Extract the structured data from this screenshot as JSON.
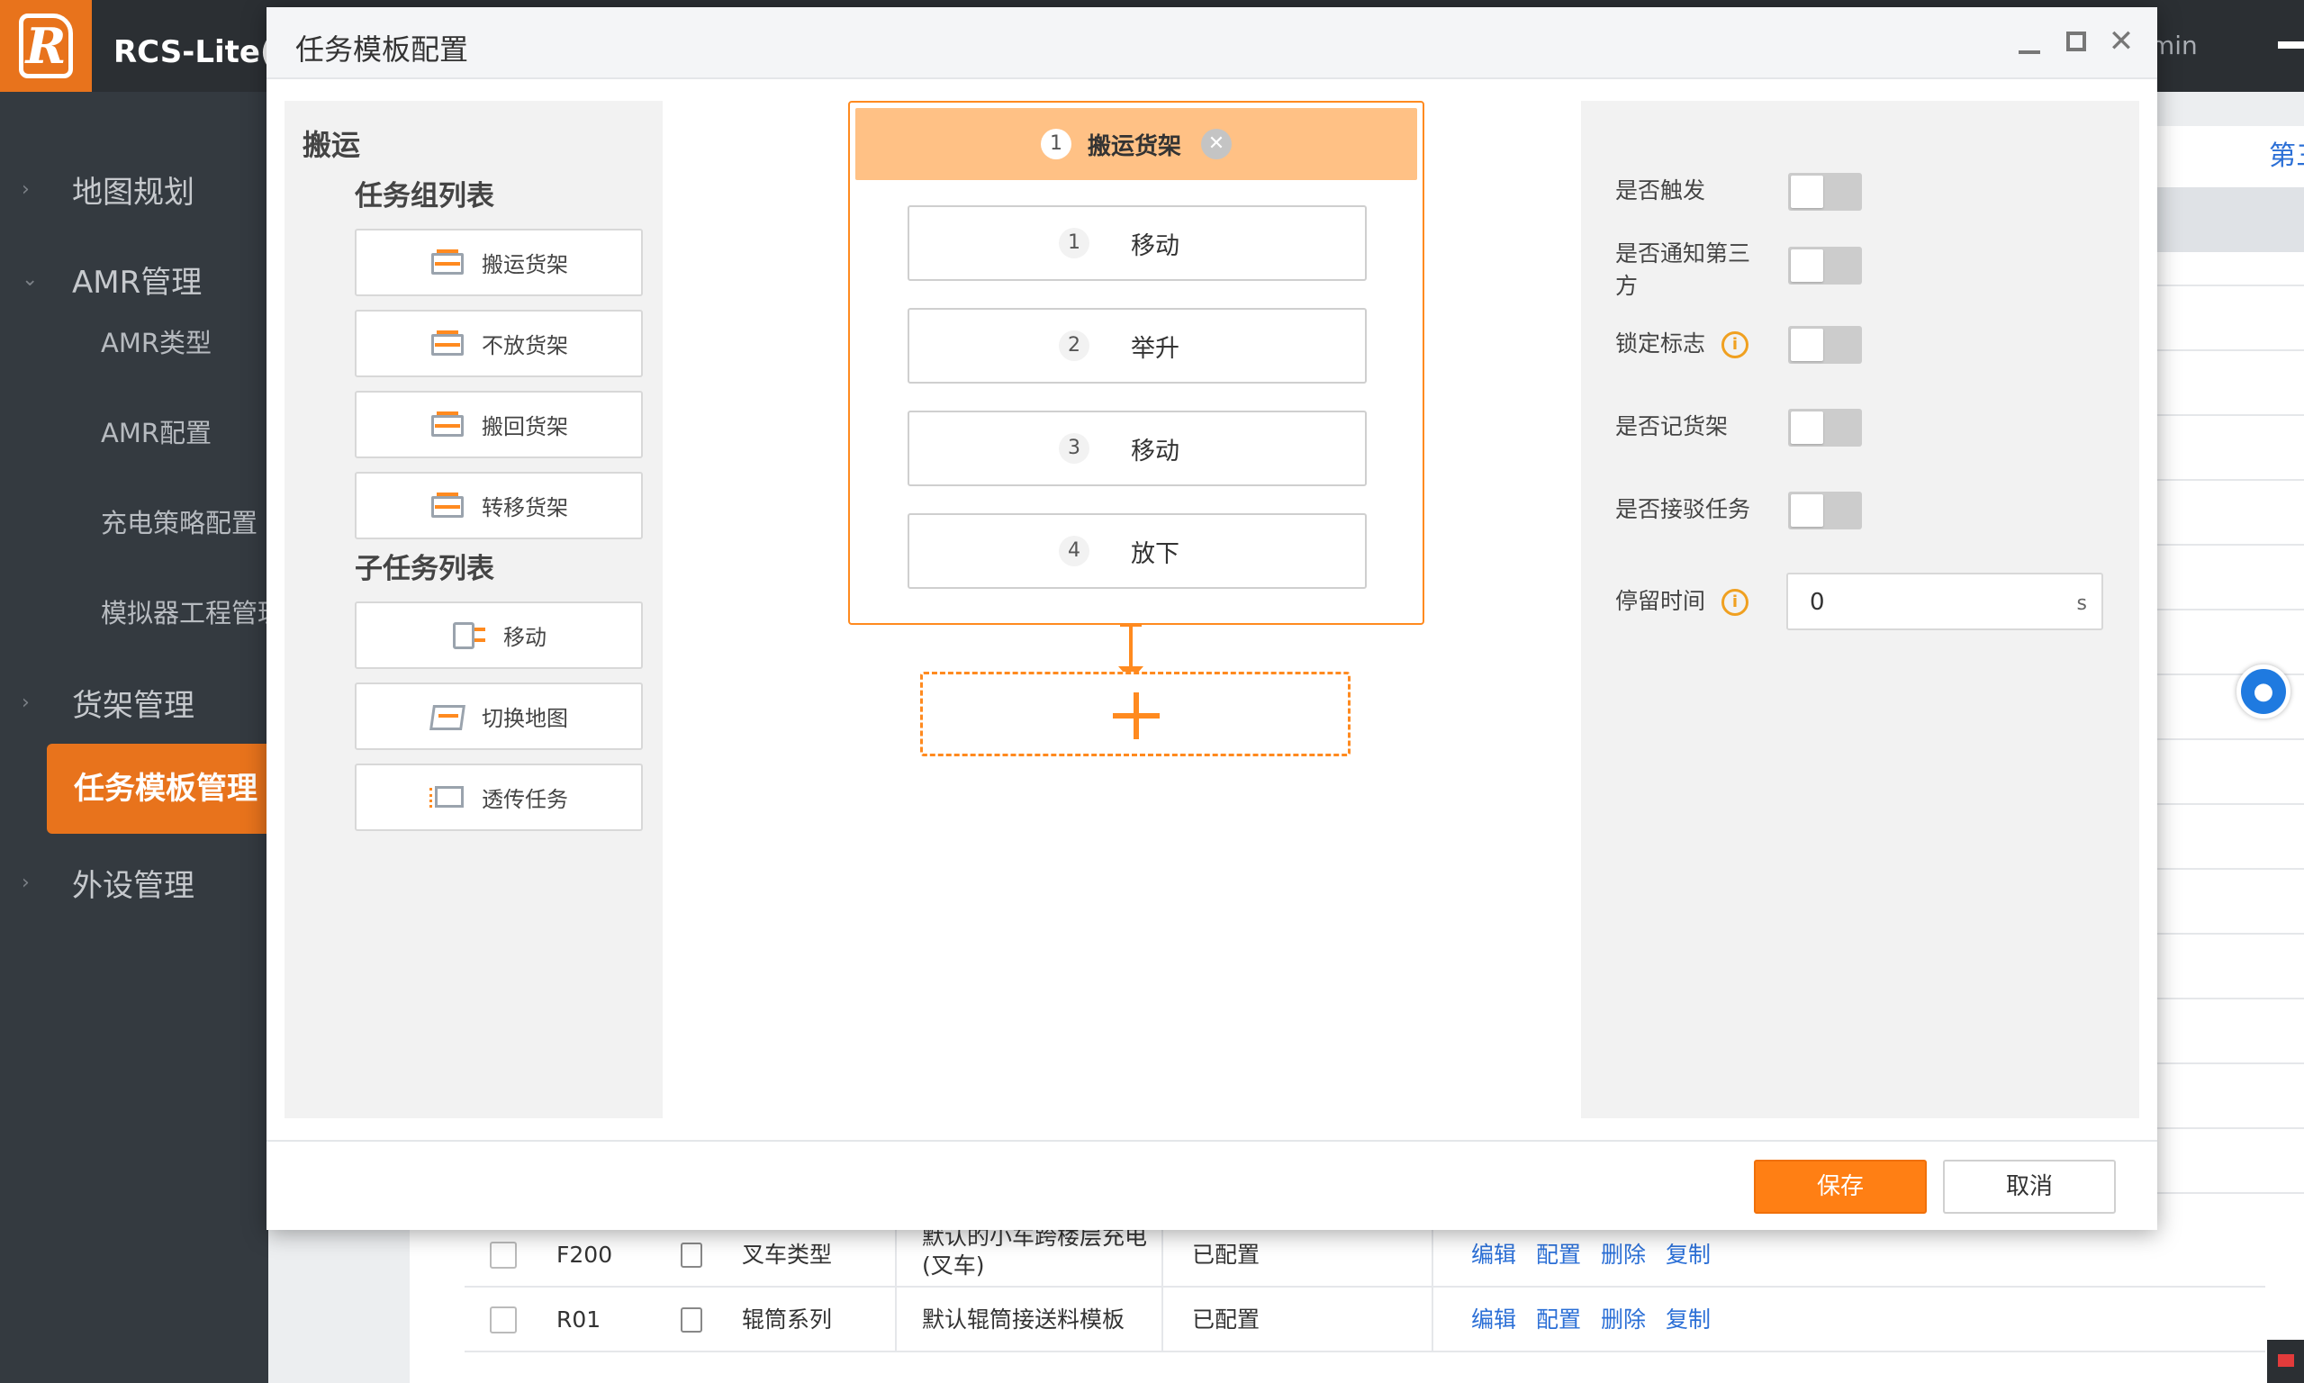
{
  "app": {
    "title": "RCS-Lite(调",
    "user_fragment": "min",
    "logo_letter": "R"
  },
  "sidebar": {
    "items": [
      {
        "label": "地图规划",
        "chevron": "›"
      },
      {
        "label": "AMR管理",
        "chevron": "⌄"
      },
      {
        "label": "货架管理",
        "chevron": "›"
      },
      {
        "label": "外设管理",
        "chevron": "›"
      }
    ],
    "sub_items": [
      "AMR类型",
      "AMR配置",
      "充电策略配置",
      "模拟器工程管理"
    ],
    "active": "任务模板管理"
  },
  "background": {
    "tab_fragment": "第三",
    "rows": [
      {
        "code": "F200",
        "type": "叉车类型",
        "desc_line1": "默认的小车跨楼层充电",
        "desc_line2": "(叉车)",
        "status": "已配置",
        "actions": [
          "编辑",
          "配置",
          "删除",
          "复制"
        ]
      },
      {
        "code": "R01",
        "type": "辊筒系列",
        "desc_line1": "默认辊筒接送料模板",
        "desc_line2": "",
        "status": "已配置",
        "actions": [
          "编辑",
          "配置",
          "删除",
          "复制"
        ]
      }
    ]
  },
  "modal": {
    "title": "任务模板配置",
    "palette": {
      "category": "搬运",
      "group_header": "任务组列表",
      "groups": [
        "搬运货架",
        "不放货架",
        "搬回货架",
        "转移货架"
      ],
      "subtask_header": "子任务列表",
      "subtasks": [
        "移动",
        "切换地图",
        "透传任务"
      ]
    },
    "flow": {
      "group_num": "1",
      "group_label": "搬运货架",
      "steps": [
        {
          "num": "1",
          "label": "移动"
        },
        {
          "num": "2",
          "label": "举升"
        },
        {
          "num": "3",
          "label": "移动"
        },
        {
          "num": "4",
          "label": "放下"
        }
      ]
    },
    "props": {
      "trigger": "是否触发",
      "notify_third": "是否通知第三方",
      "lock_flag": "锁定标志",
      "record_shelf": "是否记货架",
      "accept_reject": "是否接驳任务",
      "dwell_time": "停留时间",
      "dwell_value": "0",
      "dwell_unit": "s"
    },
    "footer": {
      "save": "保存",
      "cancel": "取消"
    }
  },
  "colors": {
    "accent": "#ff7f14",
    "flow_header": "#ffc185",
    "sidebar_bg": "#343a40",
    "link": "#2b6fd6"
  }
}
